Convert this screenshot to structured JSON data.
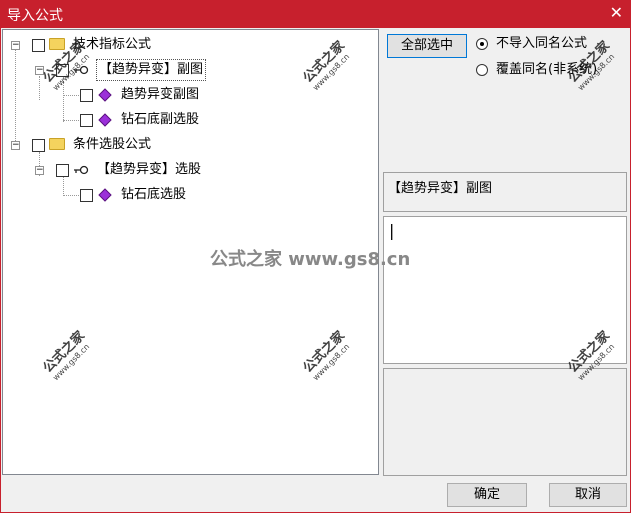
{
  "window": {
    "title": "导入公式",
    "close_glyph": "✕"
  },
  "tree": {
    "groups": [
      {
        "label": "技术指标公式",
        "children": [
          {
            "label": "【趋势异变】副图",
            "children": [
              {
                "label": "趋势异变副图"
              },
              {
                "label": "钻石底副选股"
              }
            ]
          }
        ]
      },
      {
        "label": "条件选股公式",
        "children": [
          {
            "label": "【趋势异变】选股",
            "children": [
              {
                "label": "钻石底选股"
              }
            ]
          }
        ]
      }
    ]
  },
  "options": {
    "select_all_label": "全部选中",
    "radio_no_import": "不导入同名公式",
    "radio_overwrite": "覆盖同名(非系统)",
    "selected_radio": "no_import"
  },
  "info": {
    "formula_name": "【趋势异变】副图",
    "edit_text": "|"
  },
  "buttons": {
    "ok": "确定",
    "cancel": "取消"
  },
  "watermark": {
    "brand": "公式之家",
    "url": "www.gs8.cn",
    "center": "公式之家 www.gs8.cn"
  },
  "colors": {
    "titlebar": "#c7202d",
    "folder": "#f4d35e",
    "gem": "#9b30d9"
  }
}
